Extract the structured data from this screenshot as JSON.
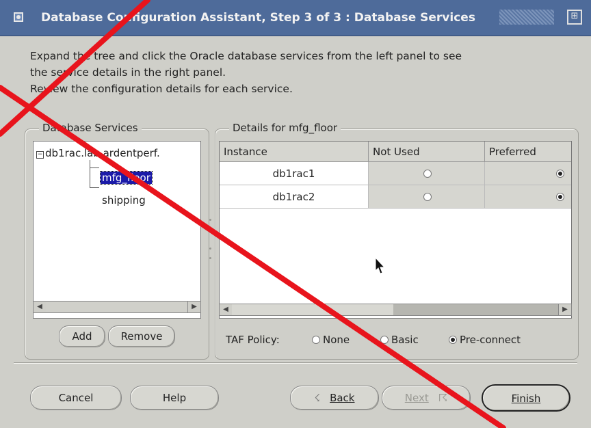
{
  "window": {
    "title": "Database Configuration Assistant, Step 3 of 3 : Database Services",
    "maximize_glyph": "⊞"
  },
  "intro": {
    "line1": "Expand the tree and click the Oracle database services from the left panel to see",
    "line2": "the service details in the right panel.",
    "line3": "Review the configuration details for each service."
  },
  "services_panel": {
    "label": "Database Services",
    "tree_root": "db1rac.lab.ardentperf.",
    "tree_expander_glyph": "−",
    "services": [
      "mfg_floor",
      "shipping"
    ],
    "selected_service": "mfg_floor",
    "add_label": "Add",
    "remove_label": "Remove"
  },
  "details_panel": {
    "label": "Details for mfg_floor",
    "columns": [
      "Instance",
      "Not Used",
      "Preferred"
    ],
    "rows": [
      {
        "instance": "db1rac1",
        "selected": "Preferred"
      },
      {
        "instance": "db1rac2",
        "selected": "Preferred"
      }
    ],
    "taf_policy_label": "TAF Policy:",
    "taf_options": [
      "None",
      "Basic",
      "Pre-connect"
    ],
    "taf_selected": "Pre-connect"
  },
  "buttons": {
    "cancel": "Cancel",
    "help": "Help",
    "back": "Back",
    "next": "Next",
    "finish": "Finish",
    "back_glyph": "☇",
    "next_glyph": "☈"
  },
  "scroll_glyphs": {
    "left": "◀",
    "right": "▶"
  },
  "colors": {
    "title_bar": "#4e6b9a",
    "selection": "#1b1aa8",
    "overlay_cross": "#e8141c"
  }
}
